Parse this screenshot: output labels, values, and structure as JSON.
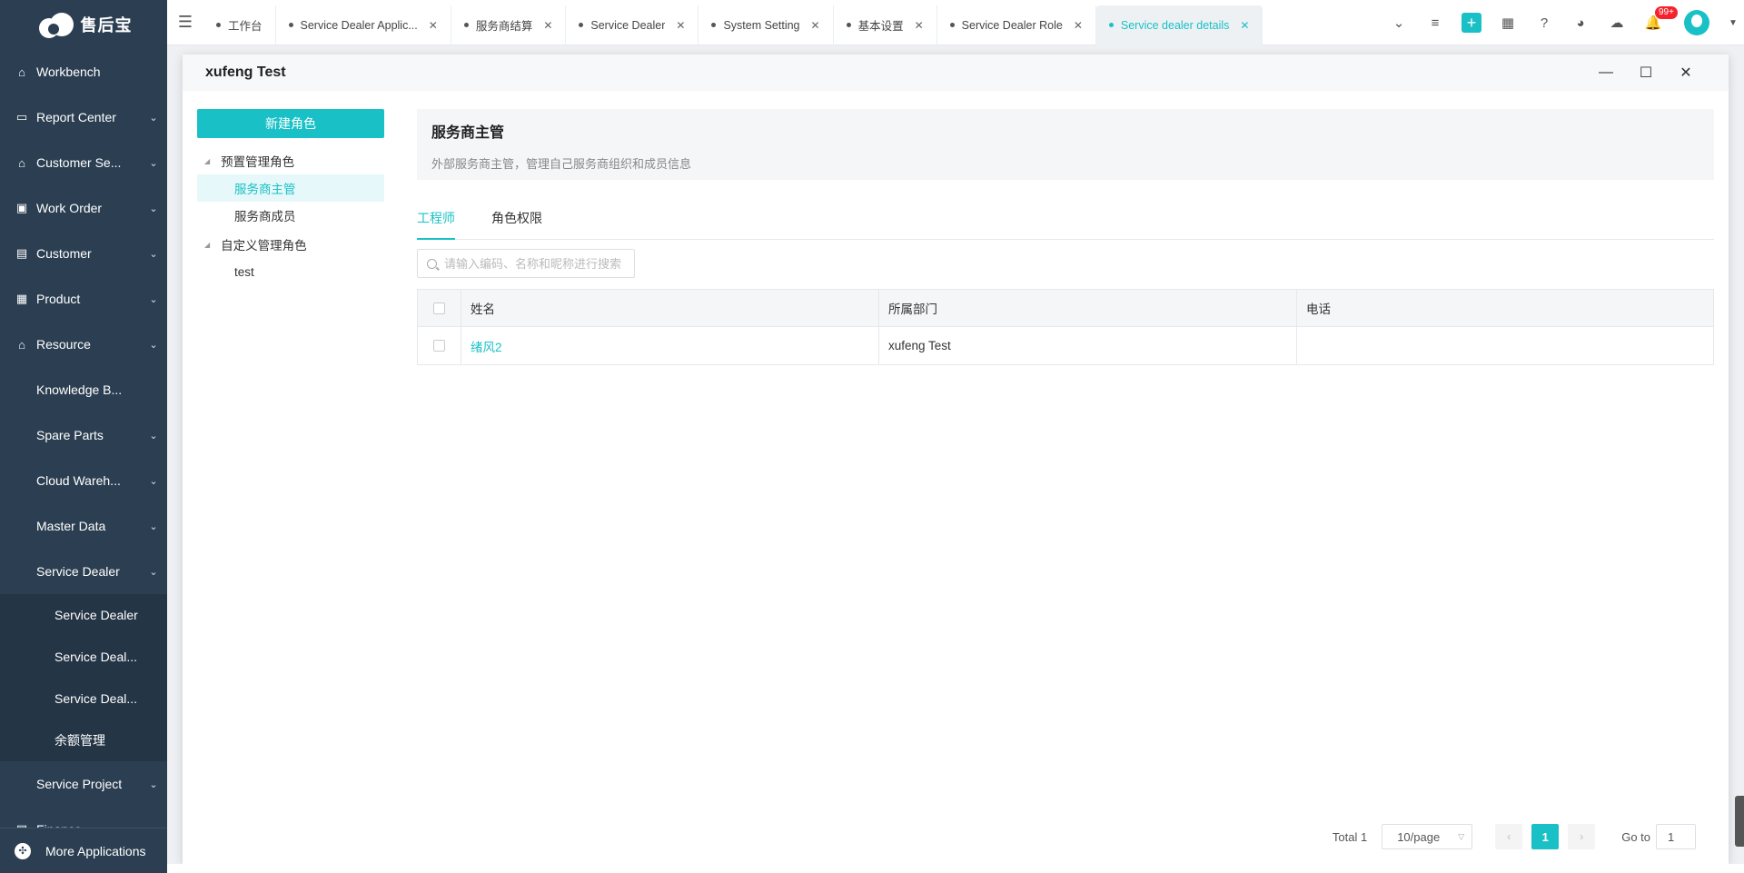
{
  "app": {
    "logo_text": "售后宝"
  },
  "sidebar": {
    "items": [
      {
        "label": "Workbench",
        "icon": "home-icon",
        "chevron": false,
        "level": 0
      },
      {
        "label": "Report Center",
        "icon": "monitor-icon",
        "chevron": true,
        "level": 0
      },
      {
        "label": "Customer Se...",
        "icon": "customer-service-icon",
        "chevron": true,
        "level": 0
      },
      {
        "label": "Work Order",
        "icon": "clipboard-icon",
        "chevron": true,
        "level": 0
      },
      {
        "label": "Customer",
        "icon": "contact-card-icon",
        "chevron": true,
        "level": 0
      },
      {
        "label": "Product",
        "icon": "product-box-icon",
        "chevron": true,
        "level": 0
      },
      {
        "label": "Resource",
        "icon": "resource-home-icon",
        "chevron": true,
        "level": 0
      },
      {
        "label": "Knowledge B...",
        "chevron": false,
        "level": 1
      },
      {
        "label": "Spare Parts",
        "chevron": true,
        "level": 1
      },
      {
        "label": "Cloud Wareh...",
        "chevron": true,
        "level": 1
      },
      {
        "label": "Master Data",
        "chevron": true,
        "level": 1
      },
      {
        "label": "Service Dealer",
        "chevron": true,
        "level": 1
      },
      {
        "label": "Service Dealer",
        "chevron": false,
        "level": 2
      },
      {
        "label": "Service Deal...",
        "chevron": false,
        "level": 2
      },
      {
        "label": "Service Deal...",
        "chevron": false,
        "level": 2
      },
      {
        "label": "余额管理",
        "chevron": false,
        "level": 2
      },
      {
        "label": "Service Project",
        "chevron": true,
        "level": 1
      },
      {
        "label": "Finance",
        "icon": "finance-icon",
        "chevron": true,
        "level": 0
      }
    ],
    "more_apps": "More Applications"
  },
  "tabs": [
    {
      "label": "工作台",
      "closable": false,
      "active": false
    },
    {
      "label": "Service Dealer Applic...",
      "closable": true,
      "active": false
    },
    {
      "label": "服务商结算",
      "closable": true,
      "active": false
    },
    {
      "label": "Service Dealer",
      "closable": true,
      "active": false
    },
    {
      "label": "System Setting",
      "closable": true,
      "active": false
    },
    {
      "label": "基本设置",
      "closable": true,
      "active": false
    },
    {
      "label": "Service Dealer Role",
      "closable": true,
      "active": false
    },
    {
      "label": "Service dealer details",
      "closable": true,
      "active": true
    }
  ],
  "top_actions": {
    "badge": "99+"
  },
  "modal": {
    "title": "xufeng Test",
    "new_role_button": "新建角色",
    "tree": [
      {
        "group": "预置管理角色",
        "children": [
          {
            "label": "服务商主管",
            "active": true
          },
          {
            "label": "服务商成员",
            "active": false
          }
        ]
      },
      {
        "group": "自定义管理角色",
        "children": [
          {
            "label": "test",
            "active": false
          }
        ]
      }
    ],
    "role_info": {
      "title": "服务商主管",
      "description": "外部服务商主管，管理自己服务商组织和成员信息"
    },
    "role_tabs": [
      {
        "label": "工程师",
        "active": true
      },
      {
        "label": "角色权限",
        "active": false
      }
    ],
    "search": {
      "placeholder": "请输入编码、名称和昵称进行搜索",
      "value": ""
    },
    "table": {
      "columns": [
        "姓名",
        "所属部门",
        "电话"
      ],
      "rows": [
        {
          "name": "绪风2",
          "department": "xufeng Test",
          "phone": ""
        }
      ]
    },
    "pager": {
      "total": "Total 1",
      "page_size": "10/page",
      "current_page": "1",
      "goto_label": "Go to",
      "goto_value": "1"
    }
  },
  "colors": {
    "accent": "#19c1c6",
    "sidebar_bg": "#2c3f52"
  }
}
